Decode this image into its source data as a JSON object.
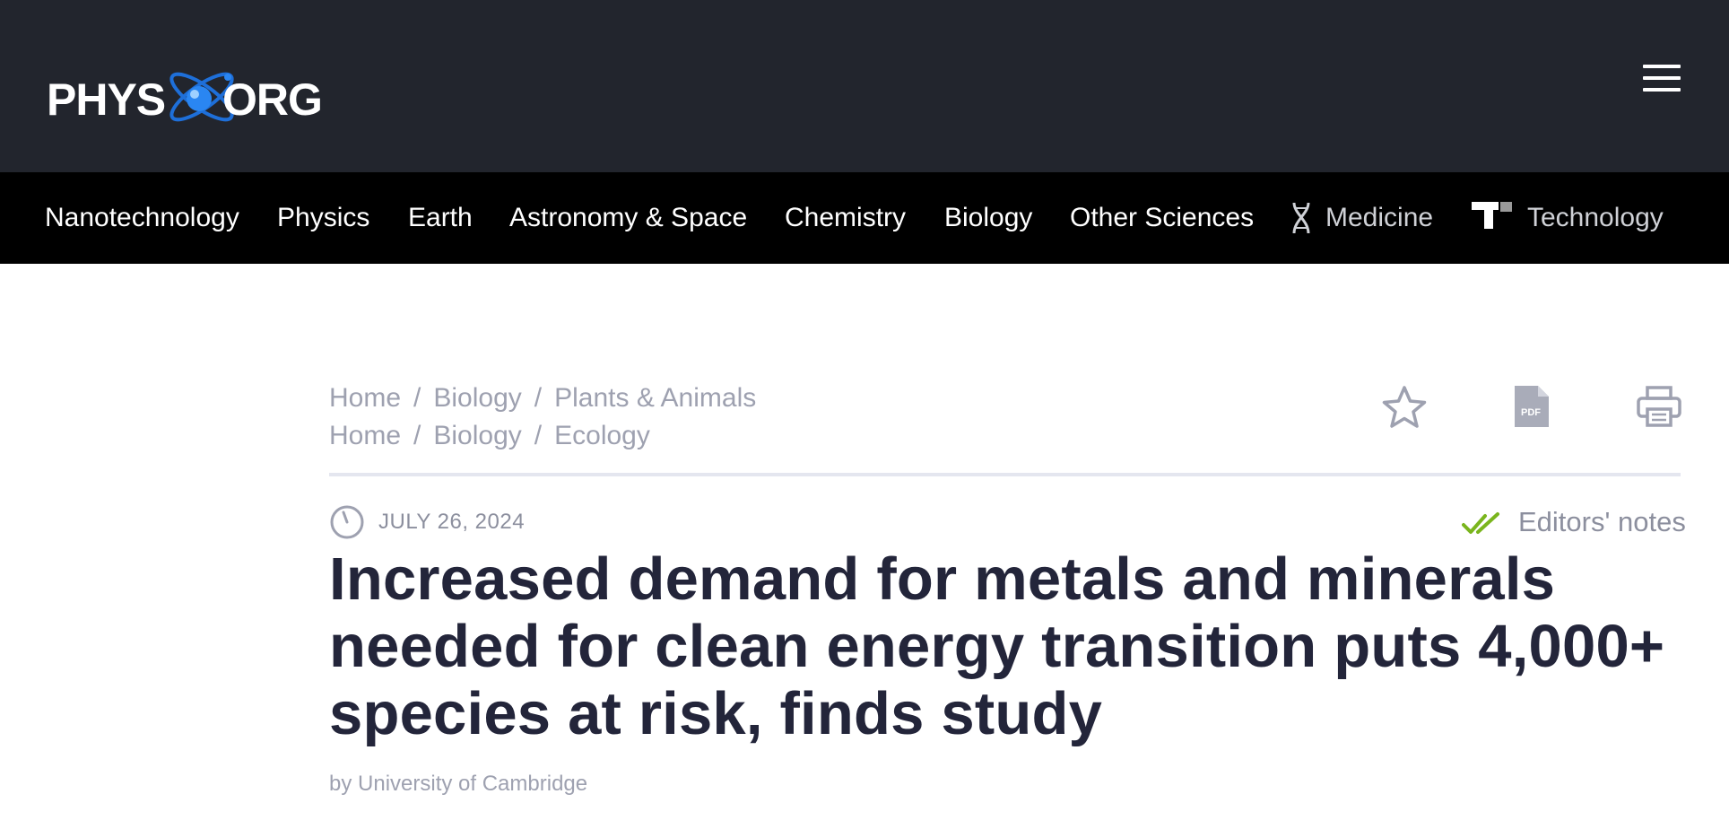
{
  "site": {
    "logo_left": "PHYS",
    "logo_right": "ORG",
    "menu_icon": "hamburger-menu-icon"
  },
  "categories": [
    {
      "label": "Nanotechnology"
    },
    {
      "label": "Physics"
    },
    {
      "label": "Earth"
    },
    {
      "label": "Astronomy & Space"
    },
    {
      "label": "Chemistry"
    },
    {
      "label": "Biology"
    },
    {
      "label": "Other Sciences"
    },
    {
      "label": "Medicine",
      "icon": "dna-icon"
    },
    {
      "label": "Technology",
      "icon": "tech-logo-icon"
    }
  ],
  "breadcrumbs": [
    [
      "Home",
      "Biology",
      "Plants & Animals"
    ],
    [
      "Home",
      "Biology",
      "Ecology"
    ]
  ],
  "breadcrumb_separator": "/",
  "tools": {
    "bookmark_icon": "star-icon",
    "pdf_icon": "pdf-icon",
    "pdf_label": "PDF",
    "print_icon": "print-icon"
  },
  "article": {
    "date": "JULY 26, 2024",
    "editors_notes": "Editors' notes",
    "title": "Increased demand for metals and minerals needed for clean energy transition puts 4,000+ species at risk, finds study",
    "byline": "by University of Cambridge"
  },
  "colors": {
    "header_bg": "#22252d",
    "nav_bg": "#000000",
    "headline": "#23253a",
    "muted_text": "#9ea1b0",
    "check_green": "#7ab51d",
    "logo_blue": "#1e6fd9"
  }
}
